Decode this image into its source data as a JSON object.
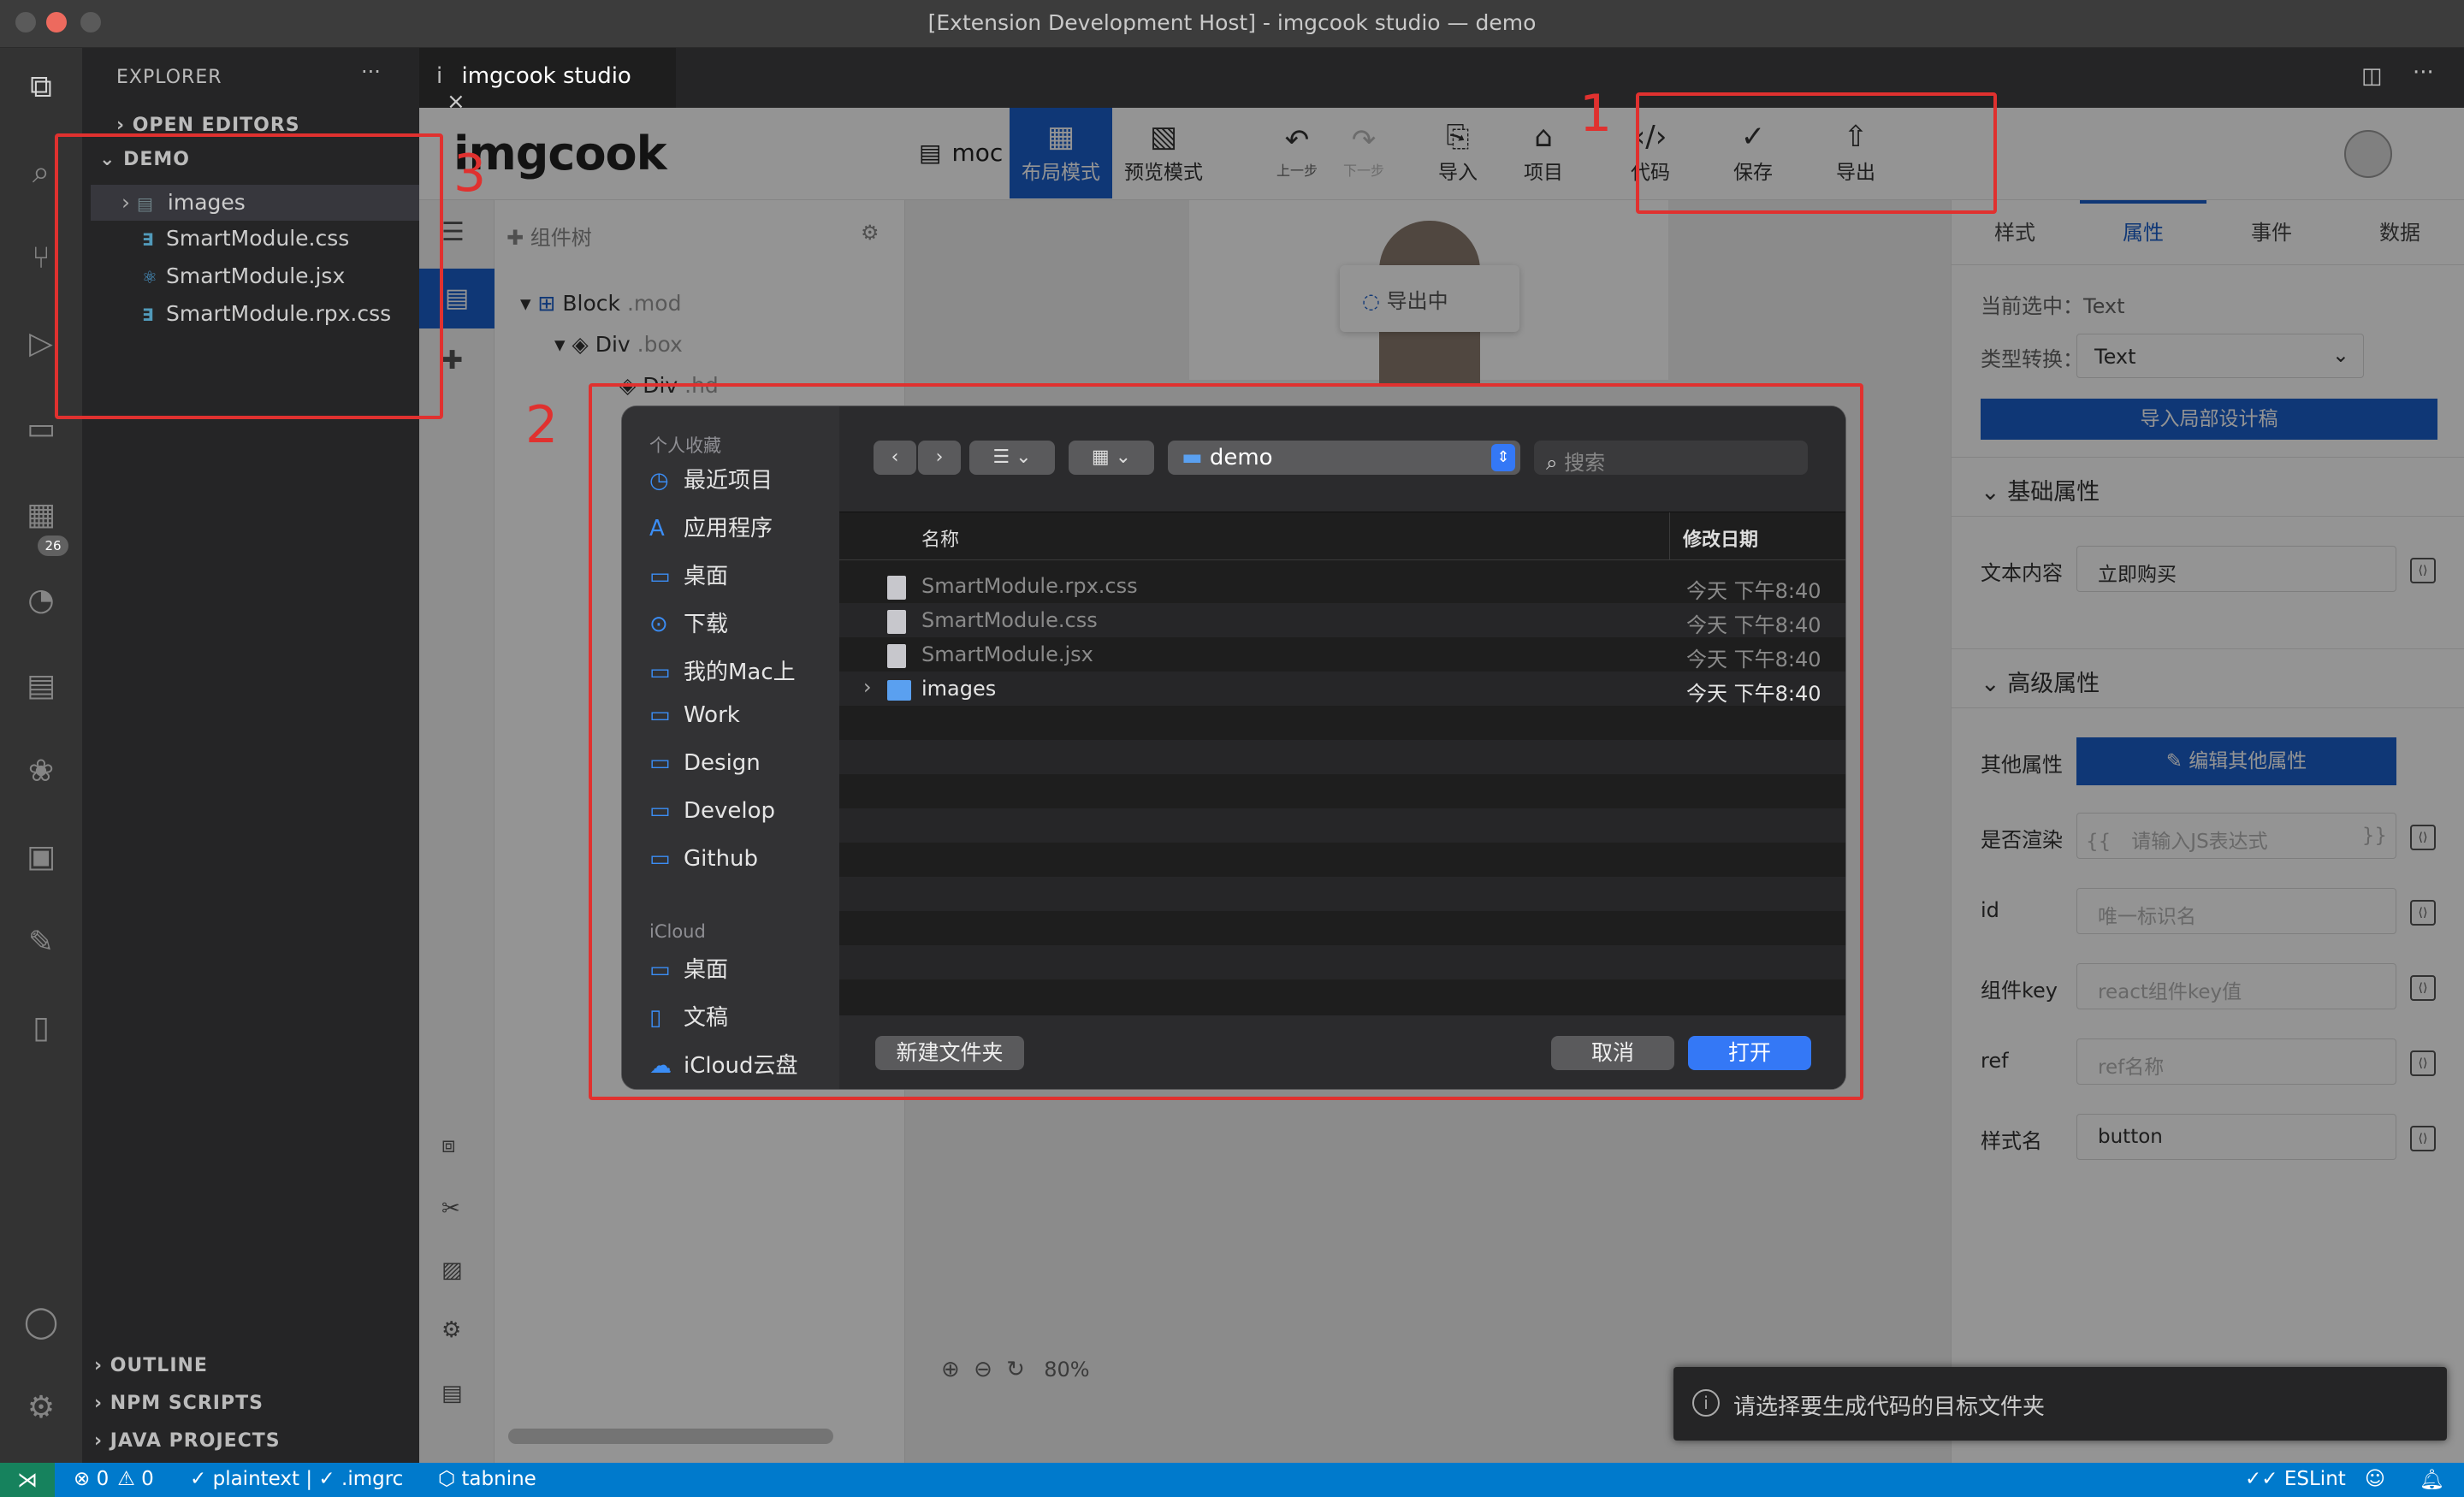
{
  "window": {
    "title": "[Extension Development Host] - imgcook studio — demo"
  },
  "sidebar": {
    "explorer_label": "EXPLORER",
    "more": "···",
    "open_editors": "OPEN EDITORS",
    "folder": "DEMO",
    "items": [
      {
        "label": "images",
        "kind": "folder"
      },
      {
        "label": "SmartModule.css",
        "kind": "css"
      },
      {
        "label": "SmartModule.jsx",
        "kind": "jsx"
      },
      {
        "label": "SmartModule.rpx.css",
        "kind": "css"
      }
    ],
    "sections": [
      "OUTLINE",
      "NPM SCRIPTS",
      "JAVA PROJECTS"
    ],
    "badge": "26"
  },
  "tabs": [
    {
      "label": "imgcook studio",
      "prefix": "i"
    }
  ],
  "imgcook": {
    "logo": "imgcook",
    "module_label": "moc",
    "toolbar": {
      "layout_mode": "布局模式",
      "preview_mode": "预览模式",
      "undo": "上一步",
      "redo": "下一步",
      "import": "导入",
      "project": "项目",
      "code": "代码",
      "save": "保存",
      "export": "导出"
    },
    "comp_tree": {
      "title": "组件树",
      "nodes": [
        {
          "name": "Block",
          "cls": ".mod"
        },
        {
          "name": "Div",
          "cls": ".box"
        },
        {
          "name": "Div",
          "cls": ".hd"
        }
      ]
    },
    "exporting": "导出中",
    "zoom": "80%",
    "right_tabs": [
      "样式",
      "属性",
      "事件",
      "数据"
    ],
    "current_label": "当前选中：",
    "current_value": "Text",
    "type_label": "类型转换：",
    "type_value": "Text",
    "import_design_btn": "导入局部设计稿",
    "basic_section": "基础属性",
    "text_content_label": "文本内容",
    "text_content_value": "立即购买",
    "advanced_section": "高级属性",
    "other_attr_label": "其他属性",
    "edit_other_btn": "编辑其他属性",
    "render_label": "是否渲染",
    "render_prefix": "{{",
    "render_ph": "请输入JS表达式",
    "render_suffix": "}}",
    "id_label": "id",
    "id_ph": "唯一标识名",
    "key_label": "组件key",
    "key_ph": "react组件key值",
    "ref_label": "ref",
    "ref_ph": "ref名称",
    "style_label": "样式名",
    "style_value": "button"
  },
  "dialog": {
    "favorites_header": "个人收藏",
    "favorites": [
      {
        "label": "最近项目",
        "icon": "clock-icon"
      },
      {
        "label": "应用程序",
        "icon": "app-icon"
      },
      {
        "label": "桌面",
        "icon": "desktop-icon"
      },
      {
        "label": "下载",
        "icon": "download-icon"
      },
      {
        "label": "我的Mac上",
        "icon": "folder-icon"
      },
      {
        "label": "Work",
        "icon": "folder-icon"
      },
      {
        "label": "Design",
        "icon": "folder-icon"
      },
      {
        "label": "Develop",
        "icon": "folder-icon"
      },
      {
        "label": "Github",
        "icon": "folder-icon"
      }
    ],
    "icloud_header": "iCloud",
    "icloud": [
      {
        "label": "桌面",
        "icon": "desktop-icon"
      },
      {
        "label": "文稿",
        "icon": "document-icon"
      },
      {
        "label": "iCloud云盘",
        "icon": "cloud-icon"
      }
    ],
    "location": "demo",
    "search_ph": "搜索",
    "col_name": "名称",
    "col_date": "修改日期",
    "files": [
      {
        "name": "SmartModule.rpx.css",
        "date": "今天 下午8:40",
        "enabled": false
      },
      {
        "name": "SmartModule.css",
        "date": "今天 下午8:40",
        "enabled": false
      },
      {
        "name": "SmartModule.jsx",
        "date": "今天 下午8:40",
        "enabled": false
      },
      {
        "name": "images",
        "date": "今天 下午8:40",
        "enabled": true
      }
    ],
    "new_folder": "新建文件夹",
    "cancel": "取消",
    "open": "打开"
  },
  "annotations": [
    "1",
    "2",
    "3"
  ],
  "toast": {
    "text": "请选择要生成代码的目标文件夹"
  },
  "status": {
    "errors": "0",
    "warnings": "0",
    "plaintext": "plaintext |",
    "imgrc": ".imgrc",
    "tabnine": "tabnine",
    "eslint": "ESLint"
  },
  "colors": {
    "accent": "#1b5fcc",
    "annotation": "#e0312f",
    "statusbar": "#007acc"
  }
}
